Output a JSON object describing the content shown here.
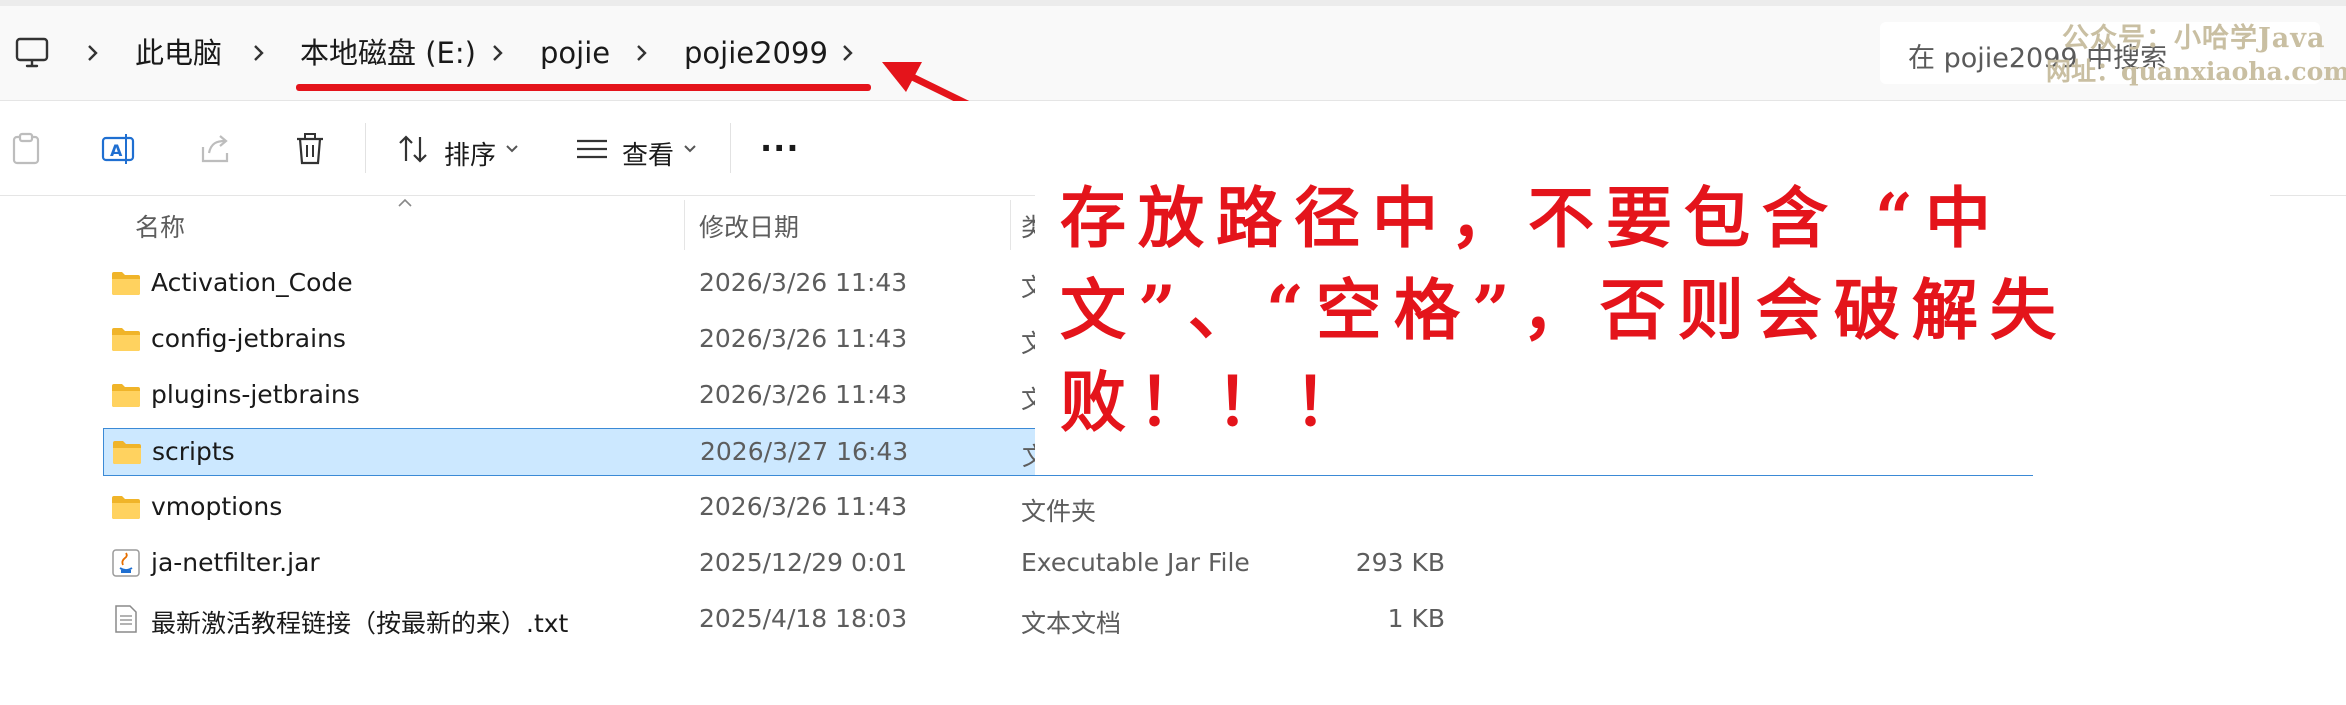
{
  "address_bar": {
    "breadcrumbs": [
      "此电脑",
      "本地磁盘 (E:)",
      "pojie",
      "pojie2099"
    ],
    "search_placeholder": "在 pojie2099 中搜索"
  },
  "watermark": {
    "line1": "公众号：小哈学Java",
    "line2": "网址：quanxiaoha.com"
  },
  "command_bar": {
    "sort_label": "排序",
    "view_label": "查看",
    "more_label": "..."
  },
  "columns": {
    "name": "名称",
    "date": "修改日期",
    "type": "类",
    "size": ""
  },
  "files": [
    {
      "name": "Activation_Code",
      "date": "2026/3/26 11:43",
      "type": "文件夹",
      "size": "",
      "icon": "folder-icon"
    },
    {
      "name": "config-jetbrains",
      "date": "2026/3/26 11:43",
      "type": "文件夹",
      "size": "",
      "icon": "folder-icon"
    },
    {
      "name": "plugins-jetbrains",
      "date": "2026/3/26 11:43",
      "type": "文件夹",
      "size": "",
      "icon": "folder-icon"
    },
    {
      "name": "scripts",
      "date": "2026/3/27 16:43",
      "type": "文件夹",
      "size": "",
      "icon": "folder-icon",
      "selected": true
    },
    {
      "name": "vmoptions",
      "date": "2026/3/26 11:43",
      "type": "文件夹",
      "size": "",
      "icon": "folder-icon"
    },
    {
      "name": "ja-netfilter.jar",
      "date": "2025/12/29 0:01",
      "type": "Executable Jar File",
      "size": "293 KB",
      "icon": "java-jar-icon"
    },
    {
      "name": "最新激活教程链接（按最新的来）.txt",
      "date": "2025/4/18 18:03",
      "type": "文本文档",
      "size": "1 KB",
      "icon": "text-file-icon"
    }
  ],
  "annotation": {
    "text": "存放路径中，不要包含 “中文”、“空格”，否则会破解失败！！！"
  },
  "colors": {
    "accent_red": "#e4141b",
    "selection": "#cce8ff",
    "folder": "#f5c242"
  }
}
